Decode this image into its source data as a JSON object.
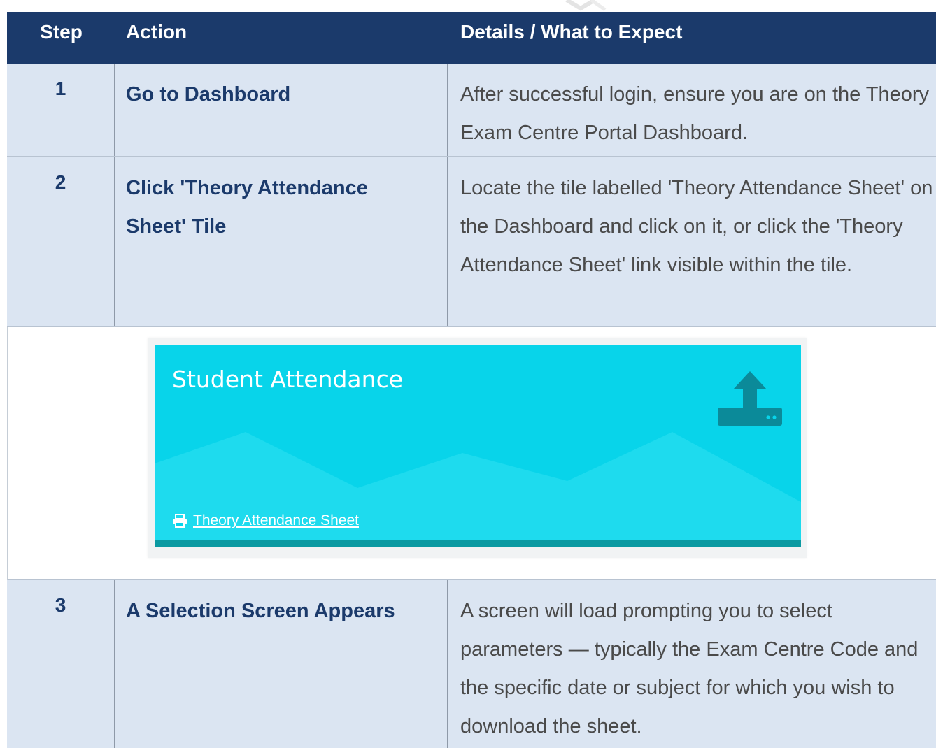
{
  "table": {
    "headers": {
      "step": "Step",
      "action": "Action",
      "details": "Details / What to Expect"
    },
    "rows": [
      {
        "step": "1",
        "action": "Go to Dashboard",
        "details": "After successful login, ensure you are on the Theory Exam Centre Portal Dashboard."
      },
      {
        "step": "2",
        "action": "Click 'Theory Attendance Sheet' Tile",
        "details": "Locate the tile labelled 'Theory Attendance Sheet' on the Dashboard and click on it, or click the 'Theory Attendance Sheet' link visible within the tile."
      },
      {
        "step": "3",
        "action": "A Selection Screen Appears",
        "details": "A screen will load prompting you to select parameters — typically the Exam Centre Code and the specific date or subject for which you wish to download the sheet."
      }
    ]
  },
  "tile": {
    "title": "Student Attendance",
    "link_label": "Theory Attendance Sheet",
    "icon": "upload-icon",
    "link_icon": "printer-icon",
    "background_color": "#08d4ea",
    "accent_color": "#0b9aa2"
  },
  "colors": {
    "header_bg": "#1b3a6b",
    "row_bg": "#dbe5f2",
    "action_text": "#1b3a6b",
    "details_text": "#4a4a4a"
  }
}
